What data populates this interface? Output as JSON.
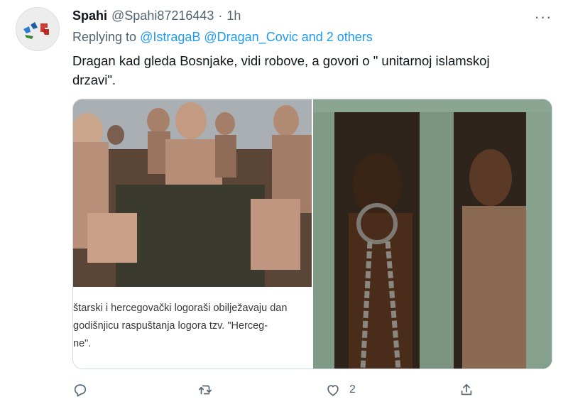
{
  "tweet": {
    "author": {
      "name": "Spahi",
      "handle": "@Spahi87216443",
      "separator": "·",
      "time": "1h",
      "avatar_icon": "avatar-symbols-icon"
    },
    "more_icon": "more-dots-icon",
    "more_label": "···",
    "replying": {
      "prefix": "Replying to ",
      "mentions": "@IstragaB @Dragan_Covic and 2 others"
    },
    "text": "Dragan kad gleda Bosnjake, vidi robove, a govori o \" unitarnoj islamskoj drzavi\".",
    "media": {
      "left_caption": "štarski i hercegovački logoraši obilježavaju dan\n godišnjicu raspuštanja logora tzv. \"Herceg-\nne\".",
      "left_image": "photo-camp-prisoners",
      "right_image": "photo-chained-slave"
    },
    "actions": {
      "reply_icon": "reply-icon",
      "retweet_icon": "retweet-icon",
      "like_icon": "heart-icon",
      "like_count": "2",
      "share_icon": "share-icon"
    },
    "colors": {
      "link": "#1d9bf0",
      "secondary": "#536471",
      "primary": "#0f1419",
      "border": "#cfd9de"
    }
  }
}
